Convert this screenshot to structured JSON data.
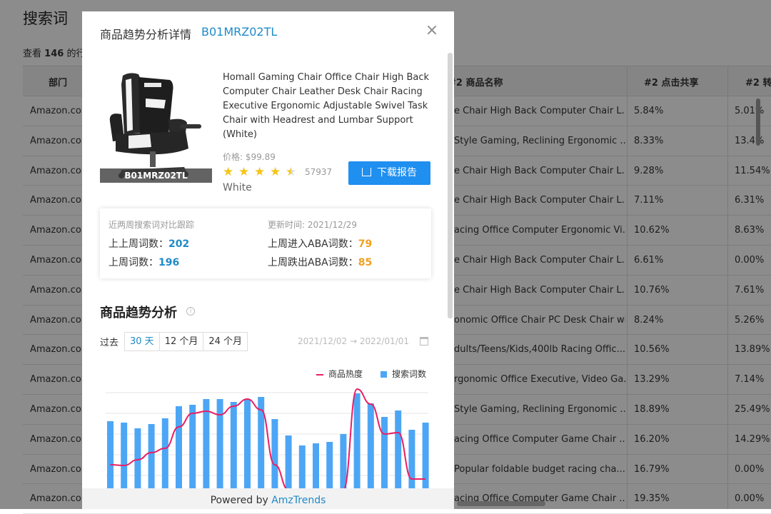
{
  "background": {
    "title": "搜索词",
    "subtitle_prefix": "查看",
    "subtitle_count": "146",
    "subtitle_suffix": "的行",
    "headers": [
      "部门",
      "#2 商品名称",
      "#2 点击共享",
      "#2 转"
    ],
    "rows": [
      [
        "Amazon.com",
        "e Chair High Back Computer Chair L...",
        "5.84%",
        "5.01%"
      ],
      [
        "Amazon.com",
        "Style Gaming, Reclining Ergonomic ...",
        "8.33%",
        "13.4%"
      ],
      [
        "Amazon.com",
        "e Chair High Back Computer Chair L...",
        "9.28%",
        "11.54%"
      ],
      [
        "Amazon.com",
        "e Chair High Back Computer Chair L...",
        "7.11%",
        "6.31%"
      ],
      [
        "Amazon.com",
        "acing Office Computer Ergonomic Vi...",
        "10.62%",
        "8.63%"
      ],
      [
        "Amazon.com",
        "e Chair High Back Computer Chair L...",
        "6.61%",
        "0.00%"
      ],
      [
        "Amazon.com",
        "e Chair High Back Computer Chair L...",
        "10.76%",
        "7.61%"
      ],
      [
        "Amazon.com",
        "onomic Office Chair PC Desk Chair wit...",
        "8.24%",
        "5.26%"
      ],
      [
        "Amazon.com",
        "dults/Teens/Kids,400lb Racing Offic...",
        "10.56%",
        "13.89%"
      ],
      [
        "Amazon.com",
        "rgonomic Office Executive, Video Ga...",
        "13.29%",
        "7.14%"
      ],
      [
        "Amazon.com",
        "Style Gaming, Reclining Ergonomic ...",
        "18.89%",
        "25.49%"
      ],
      [
        "Amazon.com",
        "acing Office Computer Game Chair ...",
        "16.20%",
        "14.29%"
      ],
      [
        "Amazon.com",
        "Popular foldable budget racing cha...",
        "16.79%",
        "0.00%"
      ],
      [
        "Amazon.com",
        "acing Office Computer Game Chair ...",
        "19.35%",
        "0.00%"
      ]
    ]
  },
  "modal": {
    "title": "商品趋势分析详情",
    "asin": "B01MRZ02TL",
    "close": "×",
    "product": {
      "image_asin": "B01MRZ02TL",
      "name": "Homall Gaming Chair Office Chair High Back Computer Chair Leather Desk Chair Racing Executive Ergonomic Adjustable Swivel Task Chair with Headrest and Lumbar Support (White)",
      "price": "价格: $99.89",
      "rating": 4.5,
      "reviews": "57937",
      "variant": "White",
      "download_label": "下载报告"
    },
    "stats": {
      "compare_label": "近两周搜索词对比跟踪",
      "updated": "更新时间: 2021/12/29",
      "prev_prev_week_label": "上上周词数：",
      "prev_prev_week_value": "202",
      "prev_week_label": "上周词数：",
      "prev_week_value": "196",
      "enter_aba_label": "上周进入ABA词数：",
      "enter_aba_value": "79",
      "drop_aba_label": "上周跌出ABA词数：",
      "drop_aba_value": "85"
    },
    "trend": {
      "title": "商品趋势分析",
      "range_label": "过去",
      "tabs": [
        "30 天",
        "12 个月",
        "24 个月"
      ],
      "active_tab": 0,
      "date_from": "2021/12/02",
      "date_arrow": "→",
      "date_to": "2022/01/01",
      "legend_line": "商品热度",
      "legend_bar": "搜索词数"
    },
    "footer_prefix": "Powered by",
    "footer_brand": "AmzTrends"
  },
  "chart_data": {
    "type": "bar",
    "series": [
      {
        "name": "搜索词数",
        "type": "bar",
        "values": [
          96,
          94,
          86,
          92,
          100,
          117,
          119,
          127,
          127,
          123,
          127,
          130,
          99,
          76,
          62,
          65,
          67,
          78,
          135,
          121,
          102,
          111,
          84,
          94
        ]
      },
      {
        "name": "商品热度",
        "type": "line",
        "values": [
          35,
          34,
          42,
          52,
          58,
          88,
          107,
          110,
          105,
          117,
          127,
          112,
          35,
          0,
          0,
          0,
          0,
          0,
          141,
          120,
          78,
          80,
          15,
          15
        ]
      }
    ],
    "colors": {
      "bar": "#4da6f5",
      "line": "#e91e63"
    },
    "grid": true
  }
}
